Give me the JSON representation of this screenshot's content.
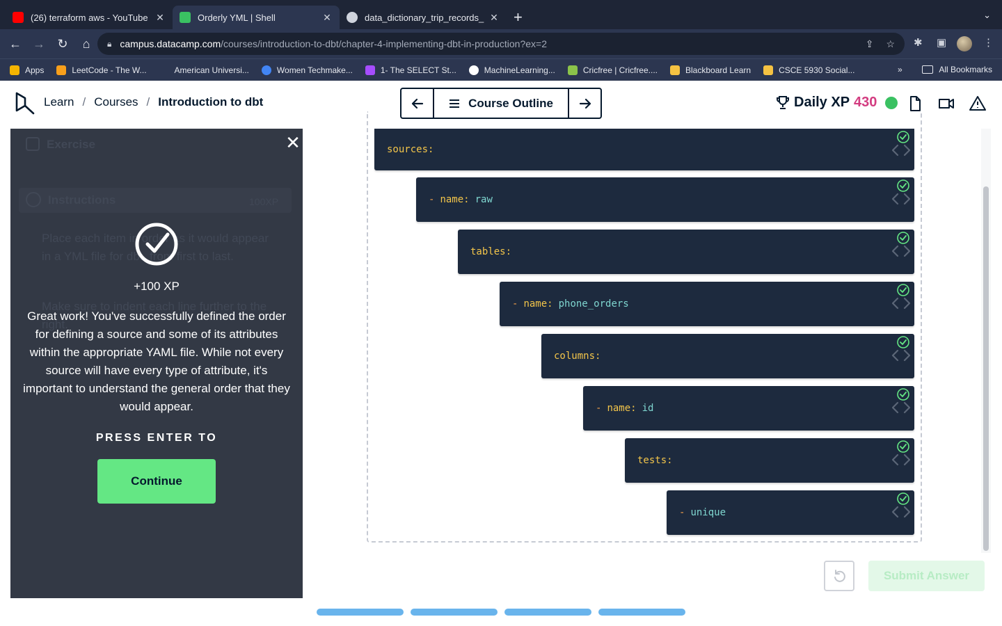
{
  "browser": {
    "tabs": [
      {
        "title": "(26) terraform aws - YouTube",
        "icon": "youtube-icon",
        "color": "#ff0000"
      },
      {
        "title": "Orderly YML | Shell",
        "icon": "datacamp-icon",
        "color": "#3ac162"
      },
      {
        "title": "data_dictionary_trip_records_",
        "icon": "globe-icon",
        "color": "#cfd3dc"
      }
    ],
    "new_tab": "+",
    "url_host": "campus.datacamp.com",
    "url_path": "/courses/introduction-to-dbt/chapter-4-implementing-dbt-in-production?ex=2",
    "bookmarks": [
      {
        "label": "Apps",
        "color": "#f4b400"
      },
      {
        "label": "LeetCode - The W...",
        "color": "#f89f1b"
      },
      {
        "label": "American Universi...",
        "color": "#2c3650"
      },
      {
        "label": "Women Techmake...",
        "color": "#4285f4"
      },
      {
        "label": "1- The SELECT St...",
        "color": "#a64dff"
      },
      {
        "label": "MachineLearning...",
        "color": "#ffffff"
      },
      {
        "label": "Cricfree | Cricfree....",
        "color": "#8bc34a"
      },
      {
        "label": "Blackboard Learn",
        "color": "#f5c242"
      },
      {
        "label": "CSCE 5930 Social...",
        "color": "#f5c242"
      }
    ],
    "bookmarks_more": "»",
    "all_bookmarks": "All Bookmarks"
  },
  "header": {
    "crumbs": [
      "Learn",
      "Courses",
      "Introduction to dbt"
    ],
    "outline_label": "Course Outline",
    "xp_label": "Daily XP",
    "xp_value": "430"
  },
  "panel": {
    "bg_exercise": "Exercise",
    "bg_instructions": "Instructions",
    "bg_xp": "100XP",
    "bg_bullet1": "Place each item in order as it would appear in a YML file for dbt, from first to last.",
    "bg_bullet2": "Make sure to indent each line further to the right.",
    "xp_gain": "+100 XP",
    "feedback": "Great work! You've successfully defined the order for defining a source and some of its attributes within the appropriate YAML file. While not every source will have every type of attribute, it's important to understand the general order that they would appear.",
    "press": "PRESS ENTER TO",
    "continue": "Continue"
  },
  "code_lines": [
    {
      "dash": "",
      "key": "sources:",
      "value": ""
    },
    {
      "dash": "-",
      "key": "name:",
      "value": "raw"
    },
    {
      "dash": "",
      "key": "tables:",
      "value": ""
    },
    {
      "dash": "-",
      "key": "name:",
      "value": "phone_orders"
    },
    {
      "dash": "",
      "key": "columns:",
      "value": ""
    },
    {
      "dash": "-",
      "key": "name:",
      "value": "id"
    },
    {
      "dash": "",
      "key": "tests:",
      "value": ""
    },
    {
      "dash": "-",
      "key": "",
      "value": "unique"
    }
  ],
  "actions": {
    "submit": "Submit Answer"
  },
  "colors": {
    "accent_green": "#64e784",
    "xp_pink": "#d33c80",
    "navy": "#05192d",
    "code_bg": "#1d2a3e",
    "progress_blue": "#69b4ec"
  }
}
